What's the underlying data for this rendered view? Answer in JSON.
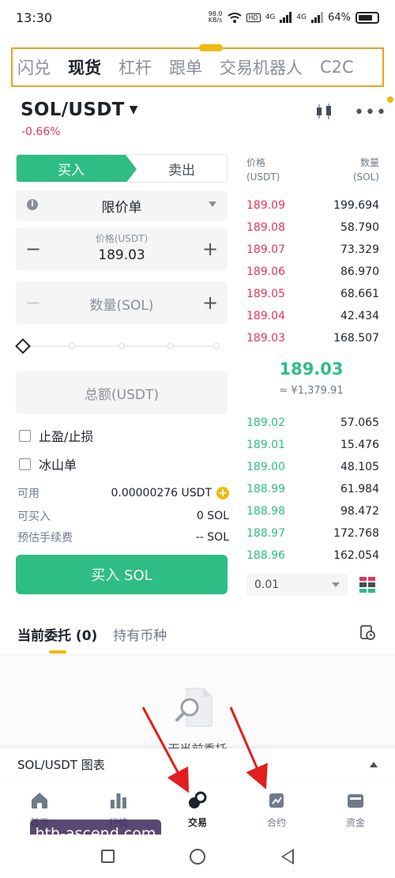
{
  "status_bar": {
    "time": "13:30",
    "net_speed_value": "98.0",
    "net_speed_unit": "KB/s",
    "hd": "HD",
    "signal_1": "4G",
    "signal_2": "4G",
    "battery": "64%"
  },
  "top_tabs": [
    "闪兑",
    "现货",
    "杠杆",
    "跟单",
    "交易机器人",
    "C2C"
  ],
  "active_tab": "现货",
  "pair": {
    "symbol": "SOL/USDT",
    "change": "-0.66%",
    "change_color": "#e5365b"
  },
  "trade_form": {
    "buy_label": "买入",
    "sell_label": "卖出",
    "order_type": "限价单",
    "price_label": "价格(USDT)",
    "price_value": "189.03",
    "quantity_placeholder": "数量(SOL)",
    "total_placeholder": "总额(USDT)",
    "tp_sl_label": "止盈/止损",
    "iceberg_label": "冰山单",
    "available_label": "可用",
    "available_value": "0.00000276 USDT",
    "can_buy_label": "可买入",
    "can_buy_value": "0 SOL",
    "fee_label": "预估手续费",
    "fee_value": "-- SOL",
    "submit_label": "买入 SOL",
    "accent_color": "#2ebd85"
  },
  "order_book": {
    "price_header": [
      "价格",
      "(USDT)"
    ],
    "qty_header": [
      "数量",
      "(SOL)"
    ],
    "asks": [
      {
        "price": "189.09",
        "qty": "199.694",
        "depth": 0.55
      },
      {
        "price": "189.08",
        "qty": "58.790",
        "depth": 0.25
      },
      {
        "price": "189.07",
        "qty": "73.329",
        "depth": 0.3
      },
      {
        "price": "189.06",
        "qty": "86.970",
        "depth": 0.35
      },
      {
        "price": "189.05",
        "qty": "68.661",
        "depth": 0.28
      },
      {
        "price": "189.04",
        "qty": "42.434",
        "depth": 0.2
      },
      {
        "price": "189.03",
        "qty": "168.507",
        "depth": 0.5
      }
    ],
    "mid_price": "189.03",
    "mid_fiat": "≈ ¥1,379.91",
    "bids": [
      {
        "price": "189.02",
        "qty": "57.065",
        "depth": 0.25
      },
      {
        "price": "189.01",
        "qty": "15.476",
        "depth": 0.1
      },
      {
        "price": "189.00",
        "qty": "48.105",
        "depth": 0.22
      },
      {
        "price": "188.99",
        "qty": "61.984",
        "depth": 0.27
      },
      {
        "price": "188.98",
        "qty": "98.472",
        "depth": 0.38
      },
      {
        "price": "188.97",
        "qty": "172.768",
        "depth": 0.55
      },
      {
        "price": "188.96",
        "qty": "162.054",
        "depth": 0.5
      }
    ],
    "precision": "0.01"
  },
  "orders": {
    "tab_open": "当前委托 (0)",
    "tab_holdings": "持有币种",
    "empty_text": "无当前委托"
  },
  "chart_bar": {
    "label": "SOL/USDT 图表"
  },
  "bottom_nav": [
    {
      "label": "首页",
      "icon": "home-icon"
    },
    {
      "label": "行情",
      "icon": "market-icon"
    },
    {
      "label": "交易",
      "icon": "trade-icon"
    },
    {
      "label": "合约",
      "icon": "futures-icon"
    },
    {
      "label": "资金",
      "icon": "wallet-icon"
    }
  ],
  "watermark": "hth-ascend.com"
}
